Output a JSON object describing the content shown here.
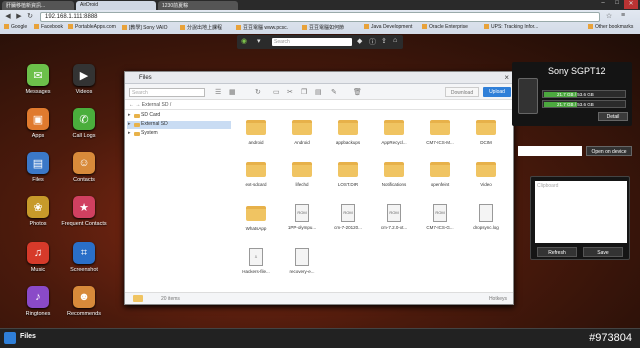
{
  "browser": {
    "tabs": [
      {
        "label": "肝臟移植新資訊..."
      },
      {
        "label": "AirDroid"
      },
      {
        "label": "1230前夏粽"
      }
    ],
    "url": "192.168.1.111:8888",
    "bookmarks": [
      "Google",
      "Facebook",
      "PortableApps.com",
      "[教學] Sony VAIO",
      "分說出地上課程",
      "豆豆電腦 www.pcsc.",
      "豆豆電腦如何節",
      "Java Development",
      "Oracle Enterprise",
      "UPS: Tracking Infor...",
      "Other bookmarks"
    ]
  },
  "toolbar": {
    "search_placeholder": "Search"
  },
  "apps": [
    {
      "label": "Messages",
      "icon": "messages-icon",
      "color": "#6cc04a",
      "glyph": "✉"
    },
    {
      "label": "Videos",
      "icon": "clapperboard-icon",
      "color": "#333333",
      "glyph": "▶"
    },
    {
      "label": "Apps",
      "icon": "box-icon",
      "color": "#e07a2e",
      "glyph": "▣"
    },
    {
      "label": "Call Logs",
      "icon": "phone-icon",
      "color": "#4aae3c",
      "glyph": "✆"
    },
    {
      "label": "Files",
      "icon": "folder-icon",
      "color": "#3b78c8",
      "glyph": "▤"
    },
    {
      "label": "Contacts",
      "icon": "contacts-icon",
      "color": "#d88a3a",
      "glyph": "☺"
    },
    {
      "label": "Photos",
      "icon": "photos-icon",
      "color": "#c79a2a",
      "glyph": "❀"
    },
    {
      "label": "Frequent Contacts",
      "icon": "frequent-contacts-icon",
      "color": "#d04060",
      "glyph": "★"
    },
    {
      "label": "Music",
      "icon": "music-icon",
      "color": "#d63a2a",
      "glyph": "♫"
    },
    {
      "label": "Screenshot",
      "icon": "screenshot-icon",
      "color": "#2a6fc8",
      "glyph": "⌗"
    },
    {
      "label": "Ringtones",
      "icon": "ringtones-icon",
      "color": "#8a4ac8",
      "glyph": "♪"
    },
    {
      "label": "Recommends",
      "icon": "recommends-icon",
      "color": "#d88a3a",
      "glyph": "☻"
    }
  ],
  "files_window": {
    "title": "Files",
    "search_placeholder": "Search",
    "download_label": "Download",
    "upload_label": "Upload",
    "breadcrumb": "External SD  /",
    "tree": [
      {
        "label": "SD Card",
        "selected": false
      },
      {
        "label": "External SD",
        "selected": true
      },
      {
        "label": "System",
        "selected": false
      }
    ],
    "items": [
      {
        "name": "android",
        "kind": "folder"
      },
      {
        "name": "Android",
        "kind": "folder"
      },
      {
        "name": "appbackups",
        "kind": "folder"
      },
      {
        "name": "AppRecycl...",
        "kind": "folder"
      },
      {
        "name": "CM7-ICS-M...",
        "kind": "folder"
      },
      {
        "name": "DCIM",
        "kind": "folder"
      },
      {
        "name": "ext-sdcard",
        "kind": "folder"
      },
      {
        "name": "lifechd",
        "kind": "folder"
      },
      {
        "name": "LOST.DIR",
        "kind": "folder"
      },
      {
        "name": "Notifications",
        "kind": "folder"
      },
      {
        "name": "openfeint",
        "kind": "folder"
      },
      {
        "name": "Video",
        "kind": "folder"
      },
      {
        "name": "WhatsApp",
        "kind": "folder"
      },
      {
        "name": "1PP-olympu...",
        "kind": "rom"
      },
      {
        "name": "cm-7-20120...",
        "kind": "rom"
      },
      {
        "name": "cm-7.2.0-xt...",
        "kind": "rom"
      },
      {
        "name": "CM7-ICS-G...",
        "kind": "rom"
      },
      {
        "name": "dropsync.log",
        "kind": "doc"
      },
      {
        "name": "Hackers-file...",
        "kind": "pdf"
      },
      {
        "name": "recovery-e...",
        "kind": "doc"
      }
    ],
    "status_count": "20 items",
    "status_right": "Hotkeys"
  },
  "device": {
    "name": "Sony SGPT12",
    "storage": [
      {
        "label": "21.7 GB / 53.6 GB",
        "fraction": 0.4
      },
      {
        "label": "21.7 GB / 53.6 GB",
        "fraction": 0.4
      }
    ],
    "detail_label": "Detail"
  },
  "url_panel": {
    "open_label": "Open on device"
  },
  "clipboard": {
    "placeholder": "Clipboard",
    "refresh_label": "Refresh",
    "save_label": "Save"
  },
  "taskbar": {
    "label": "Files"
  },
  "watermark": "#973804"
}
